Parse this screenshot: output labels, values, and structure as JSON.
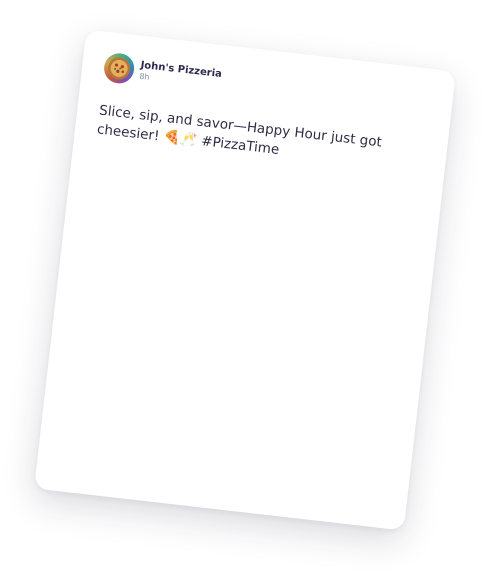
{
  "post": {
    "author": "John's Pizzeria",
    "time": "8h",
    "text": "Slice, sip, and savor—Happy Hour just got cheesier! 🍕🥂 #PizzaTime"
  },
  "icons": {
    "avatar": "pizza-logo-avatar"
  },
  "colors": {
    "card_background": "#ffffff",
    "text_primary": "#2e2d45",
    "text_secondary": "#8a8aa0"
  }
}
